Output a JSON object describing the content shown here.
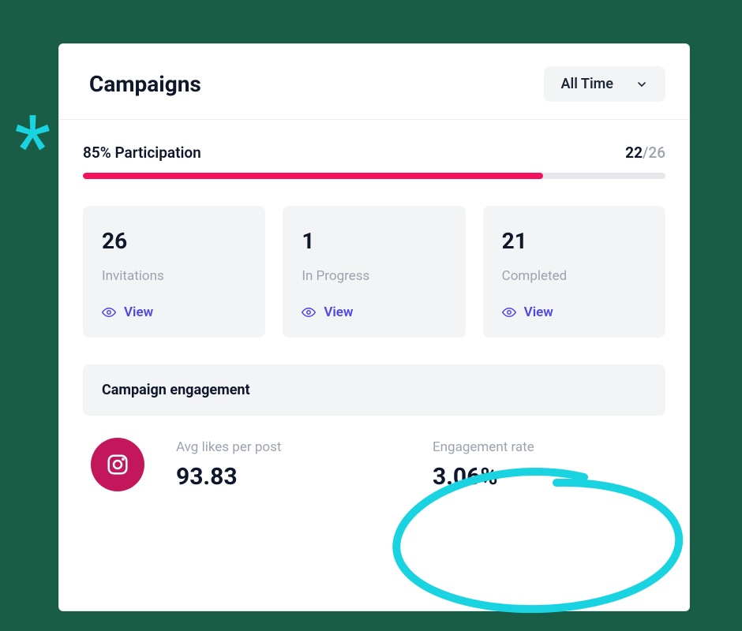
{
  "header": {
    "title": "Campaigns",
    "time_filter": "All Time"
  },
  "participation": {
    "percent_label": "85% Participation",
    "fill_percent": 79,
    "current": "22",
    "total": "/26"
  },
  "stats": [
    {
      "value": "26",
      "label": "Invitations",
      "link": "View"
    },
    {
      "value": "1",
      "label": "In Progress",
      "link": "View"
    },
    {
      "value": "21",
      "label": "Completed",
      "link": "View"
    }
  ],
  "engagement": {
    "section_title": "Campaign engagement",
    "platform": "instagram",
    "avg_likes_label": "Avg likes per post",
    "avg_likes_value": "93.83",
    "engagement_rate_label": "Engagement rate",
    "engagement_rate_value": "3.06%"
  },
  "colors": {
    "accent_pink": "#f31260",
    "link_indigo": "#4f46e5",
    "annotation_cyan": "#1ad3e0",
    "instagram_magenta": "#c2185b"
  }
}
